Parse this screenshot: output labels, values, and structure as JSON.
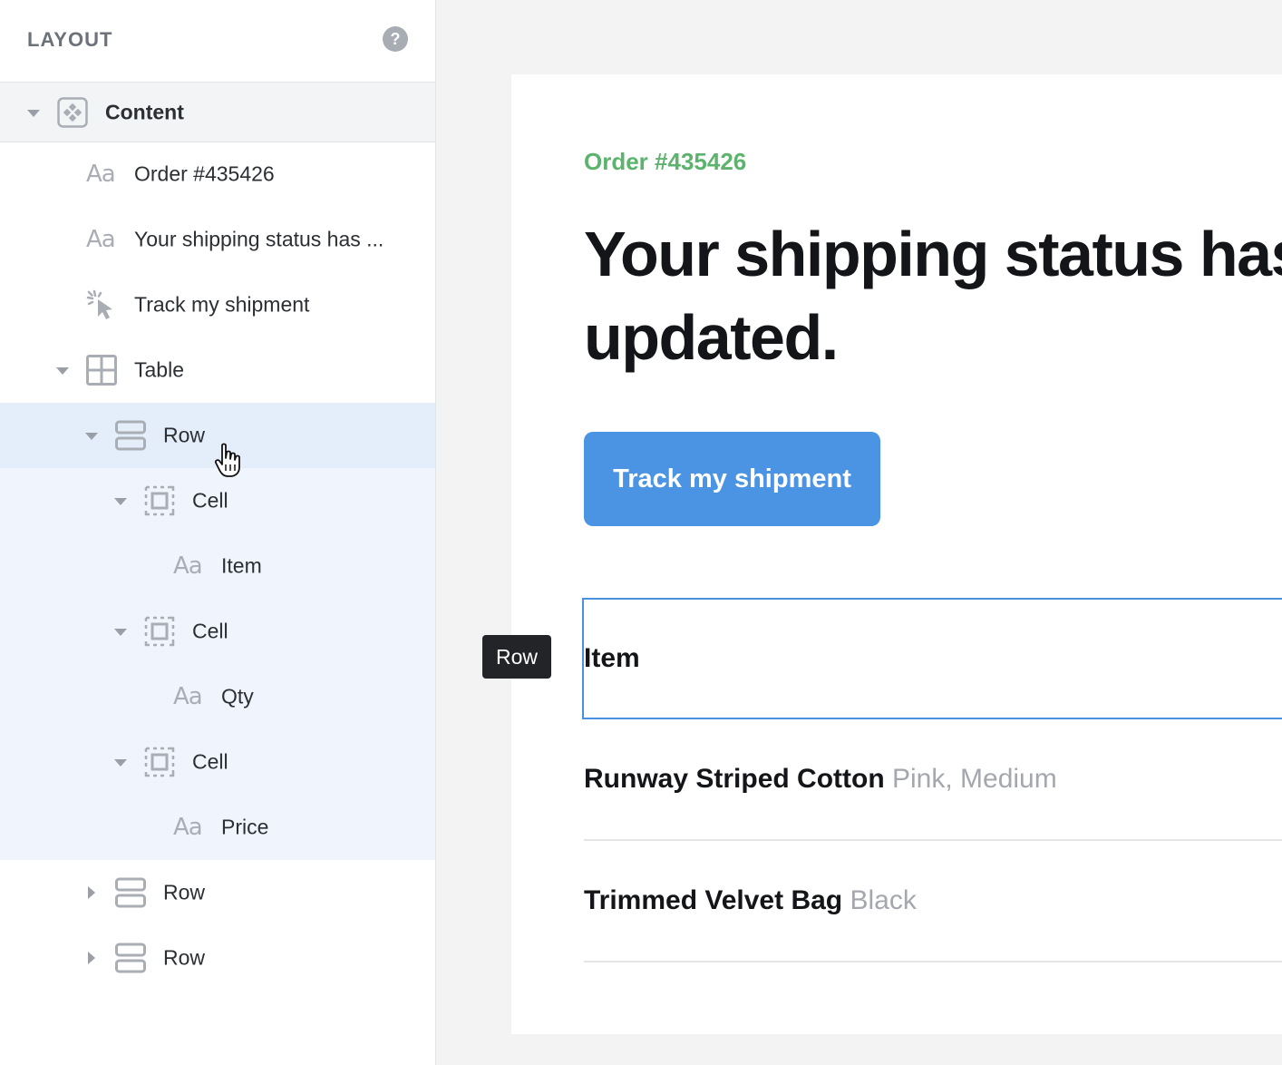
{
  "sidebar": {
    "title": "LAYOUT",
    "help": "?",
    "tree": {
      "content": "Content",
      "order": "Order #435426",
      "headline": "Your shipping status has ...",
      "track": "Track my shipment",
      "table": "Table",
      "row1": "Row",
      "cell1": "Cell",
      "item": "Item",
      "cell2": "Cell",
      "qty": "Qty",
      "cell3": "Cell",
      "price": "Price",
      "row2": "Row",
      "row3": "Row"
    }
  },
  "email": {
    "order_number": "Order #435426",
    "headline": "Your shipping status has updated.",
    "button": "Track my shipment",
    "table": {
      "header_item": "Item",
      "rows": [
        {
          "name": "Runway Striped Cotton",
          "variant": "Pink, Medium"
        },
        {
          "name": "Trimmed Velvet Bag",
          "variant": "Black"
        }
      ]
    }
  },
  "tooltip": "Row",
  "colors": {
    "accent": "#4a94e3",
    "order_green": "#5db36e",
    "selection": "#e4eefa"
  }
}
